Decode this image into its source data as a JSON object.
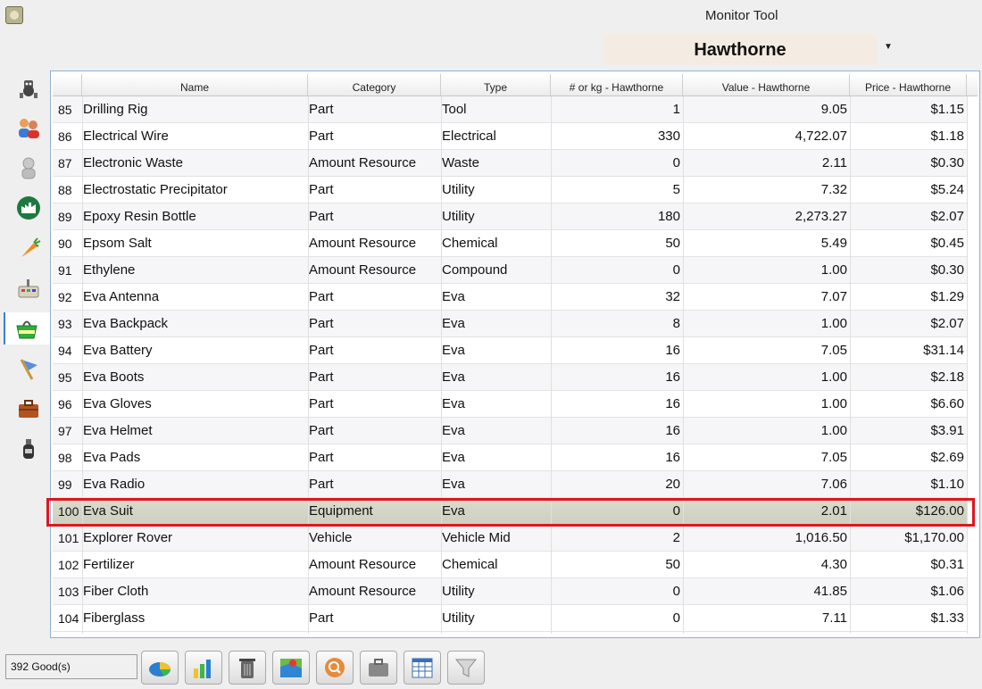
{
  "window": {
    "title": "Monitor Tool"
  },
  "settlement": {
    "selected": "Hawthorne"
  },
  "sidebar": {
    "tabs": [
      {
        "icon": "robot-bot-icon"
      },
      {
        "icon": "people-icon"
      },
      {
        "icon": "astronaut-icon"
      },
      {
        "icon": "factory-icon"
      },
      {
        "icon": "carrot-food-icon"
      },
      {
        "icon": "lab-equipment-icon"
      },
      {
        "icon": "market-basket-icon",
        "active": true
      },
      {
        "icon": "mission-flag-icon"
      },
      {
        "icon": "briefcase-icon"
      },
      {
        "icon": "bottle-icon"
      }
    ]
  },
  "table": {
    "columns": [
      "Name",
      "Category",
      "Type",
      "# or kg - Hawthorne",
      "Value - Hawthorne",
      "Price - Hawthorne"
    ],
    "rows": [
      {
        "num": "85",
        "name": "Drilling Rig",
        "category": "Part",
        "type": "Tool",
        "qty": "1",
        "value": "9.05",
        "price": "$1.15"
      },
      {
        "num": "86",
        "name": "Electrical Wire",
        "category": "Part",
        "type": "Electrical",
        "qty": "330",
        "value": "4,722.07",
        "price": "$1.18"
      },
      {
        "num": "87",
        "name": "Electronic Waste",
        "category": "Amount Resource",
        "type": "Waste",
        "qty": "0",
        "value": "2.11",
        "price": "$0.30"
      },
      {
        "num": "88",
        "name": "Electrostatic Precipitator",
        "category": "Part",
        "type": "Utility",
        "qty": "5",
        "value": "7.32",
        "price": "$5.24"
      },
      {
        "num": "89",
        "name": "Epoxy Resin Bottle",
        "category": "Part",
        "type": "Utility",
        "qty": "180",
        "value": "2,273.27",
        "price": "$2.07"
      },
      {
        "num": "90",
        "name": "Epsom Salt",
        "category": "Amount Resource",
        "type": "Chemical",
        "qty": "50",
        "value": "5.49",
        "price": "$0.45"
      },
      {
        "num": "91",
        "name": "Ethylene",
        "category": "Amount Resource",
        "type": "Compound",
        "qty": "0",
        "value": "1.00",
        "price": "$0.30"
      },
      {
        "num": "92",
        "name": "Eva Antenna",
        "category": "Part",
        "type": "Eva",
        "qty": "32",
        "value": "7.07",
        "price": "$1.29"
      },
      {
        "num": "93",
        "name": "Eva Backpack",
        "category": "Part",
        "type": "Eva",
        "qty": "8",
        "value": "1.00",
        "price": "$2.07"
      },
      {
        "num": "94",
        "name": "Eva Battery",
        "category": "Part",
        "type": "Eva",
        "qty": "16",
        "value": "7.05",
        "price": "$31.14"
      },
      {
        "num": "95",
        "name": "Eva Boots",
        "category": "Part",
        "type": "Eva",
        "qty": "16",
        "value": "1.00",
        "price": "$2.18"
      },
      {
        "num": "96",
        "name": "Eva Gloves",
        "category": "Part",
        "type": "Eva",
        "qty": "16",
        "value": "1.00",
        "price": "$6.60"
      },
      {
        "num": "97",
        "name": "Eva Helmet",
        "category": "Part",
        "type": "Eva",
        "qty": "16",
        "value": "1.00",
        "price": "$3.91"
      },
      {
        "num": "98",
        "name": "Eva Pads",
        "category": "Part",
        "type": "Eva",
        "qty": "16",
        "value": "7.05",
        "price": "$2.69"
      },
      {
        "num": "99",
        "name": "Eva Radio",
        "category": "Part",
        "type": "Eva",
        "qty": "20",
        "value": "7.06",
        "price": "$1.10"
      },
      {
        "num": "100",
        "name": "Eva Suit",
        "category": "Equipment",
        "type": "Eva",
        "qty": "0",
        "value": "2.01",
        "price": "$126.00",
        "selected": true
      },
      {
        "num": "101",
        "name": "Explorer Rover",
        "category": "Vehicle",
        "type": "Vehicle Mid",
        "qty": "2",
        "value": "1,016.50",
        "price": "$1,170.00"
      },
      {
        "num": "102",
        "name": "Fertilizer",
        "category": "Amount Resource",
        "type": "Chemical",
        "qty": "50",
        "value": "4.30",
        "price": "$0.31"
      },
      {
        "num": "103",
        "name": "Fiber Cloth",
        "category": "Amount Resource",
        "type": "Utility",
        "qty": "0",
        "value": "41.85",
        "price": "$1.06"
      },
      {
        "num": "104",
        "name": "Fiberglass",
        "category": "Part",
        "type": "Utility",
        "qty": "0",
        "value": "7.11",
        "price": "$1.33"
      }
    ]
  },
  "status": {
    "count_text": "392 Good(s)"
  },
  "toolbar": {
    "buttons": [
      {
        "icon": "pie-chart-icon"
      },
      {
        "icon": "bar-chart-icon"
      },
      {
        "icon": "trash-bin-icon"
      },
      {
        "icon": "map-icon"
      },
      {
        "icon": "search-magnifier-icon"
      },
      {
        "icon": "briefcase-icon"
      },
      {
        "icon": "table-columns-icon"
      },
      {
        "icon": "filter-funnel-icon"
      }
    ]
  },
  "colors": {
    "highlight": "#e0161e",
    "accent": "#3c7fd6",
    "settlement_bg": "#f4ebe2"
  }
}
